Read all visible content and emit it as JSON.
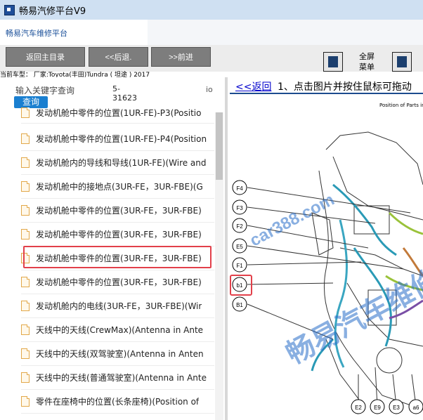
{
  "window": {
    "title": "畅易汽修平台V9"
  },
  "header": {
    "subtitle": "畅易汽车维修平台"
  },
  "toolbar": {
    "main_menu": "返回主目录",
    "back": "<<后退.",
    "forward": ">>前进",
    "fullscreen_menu_line1": "全屏",
    "fullscreen_menu_line2": "菜单"
  },
  "vehicle": {
    "info": "当前车型： 厂家:Toyota(丰田)Tundra ( 坦途 ) 2017"
  },
  "search": {
    "placeholder": "输入关键字查询",
    "button": "查询",
    "code_line1": "5-",
    "code_line2": "31623",
    "suffix": "io"
  },
  "list": {
    "items": [
      "发动机舱中零件的位置(1UR-FE)-P3(Positio",
      "发动机舱中零件的位置(1UR-FE)-P4(Position",
      "发动机舱内的导线和导线(1UR-FE)(Wire and",
      "发动机舱中的接地点(3UR-FE，3UR-FBE)(G",
      "发动机舱中零件的位置(3UR-FE，3UR-FBE)",
      "发动机舱中零件的位置(3UR-FE，3UR-FBE)",
      "发动机舱中零件的位置(3UR-FE，3UR-FBE)",
      "发动机舱中零件的位置(3UR-FE，3UR-FBE)",
      "发动机舱内的电线(3UR-FE，3UR-FBE)(Wir",
      "天线中的天线(CrewMax)(Antenna in Ante",
      "天线中的天线(双驾驶室)(Antenna in Anten",
      "天线中的天线(普通驾驶室)(Antenna in Ante",
      "零件在座椅中的位置(长条座椅)(Position of"
    ]
  },
  "content": {
    "back_link": "<<返回",
    "instruction": "1、点击图片并按住鼠标可拖动",
    "diagram_title": "Position of Parts in"
  },
  "diagram": {
    "left_callouts": [
      "F4",
      "F3",
      "F2",
      "E5",
      "F1",
      "b1",
      "B1"
    ],
    "bottom_callouts": [
      "E2",
      "E9",
      "E3",
      "a6"
    ],
    "highlighted_callout": "b1"
  },
  "watermark": {
    "site": "car388.com",
    "brand": "畅易汽车维修平台"
  },
  "colors": {
    "title_bar": "#cfe0f2",
    "nav_button": "#7d7d7d",
    "query_button": "#1a7fd0",
    "highlight": "#e2404a",
    "link": "#0000cc",
    "watermark": "#286ec8"
  }
}
